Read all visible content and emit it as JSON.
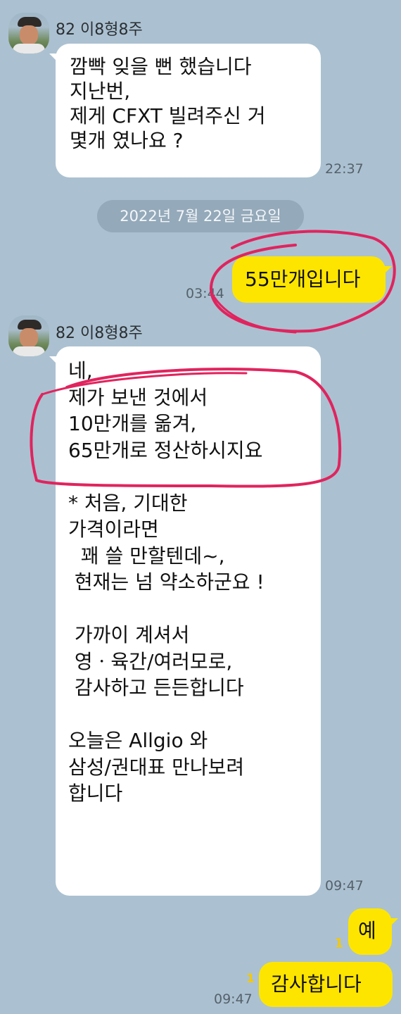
{
  "messages": {
    "sender_name": "82 이8형8주",
    "msg1": {
      "text": "깜빡 잊을 뻔 했습니다\n지난번,\n제게 CFXT 빌려주신 거\n몇개 였나요 ?",
      "time": "22:37"
    },
    "date_divider": "2022년 7월 22일 금요일",
    "msg2": {
      "text": "55만개입니다",
      "time": "03:44"
    },
    "msg3": {
      "text": "네,\n제가 보낸 것에서\n10만개를 옮겨,\n65만개로 정산하시지요\n\n* 처음, 기대한\n가격이라면\n  꽤 쓸 만할텐데~,\n 현재는 넘 약소하군요 !\n\n 가까이 계셔서\n 영ㆍ육간/여러모로,\n 감사하고 든든합니다\n\n오늘은 Allgio 와\n삼성/권대표 만나보려\n합니다",
      "time": "09:47"
    },
    "msg4": {
      "text": "예",
      "unread": "1"
    },
    "msg5": {
      "text": "감사합니다",
      "unread": "1",
      "time": "09:47"
    }
  },
  "colors": {
    "background": "#abc1d1",
    "incoming_bubble": "#ffffff",
    "outgoing_bubble": "#fee500",
    "annotation": "#e0245e"
  }
}
